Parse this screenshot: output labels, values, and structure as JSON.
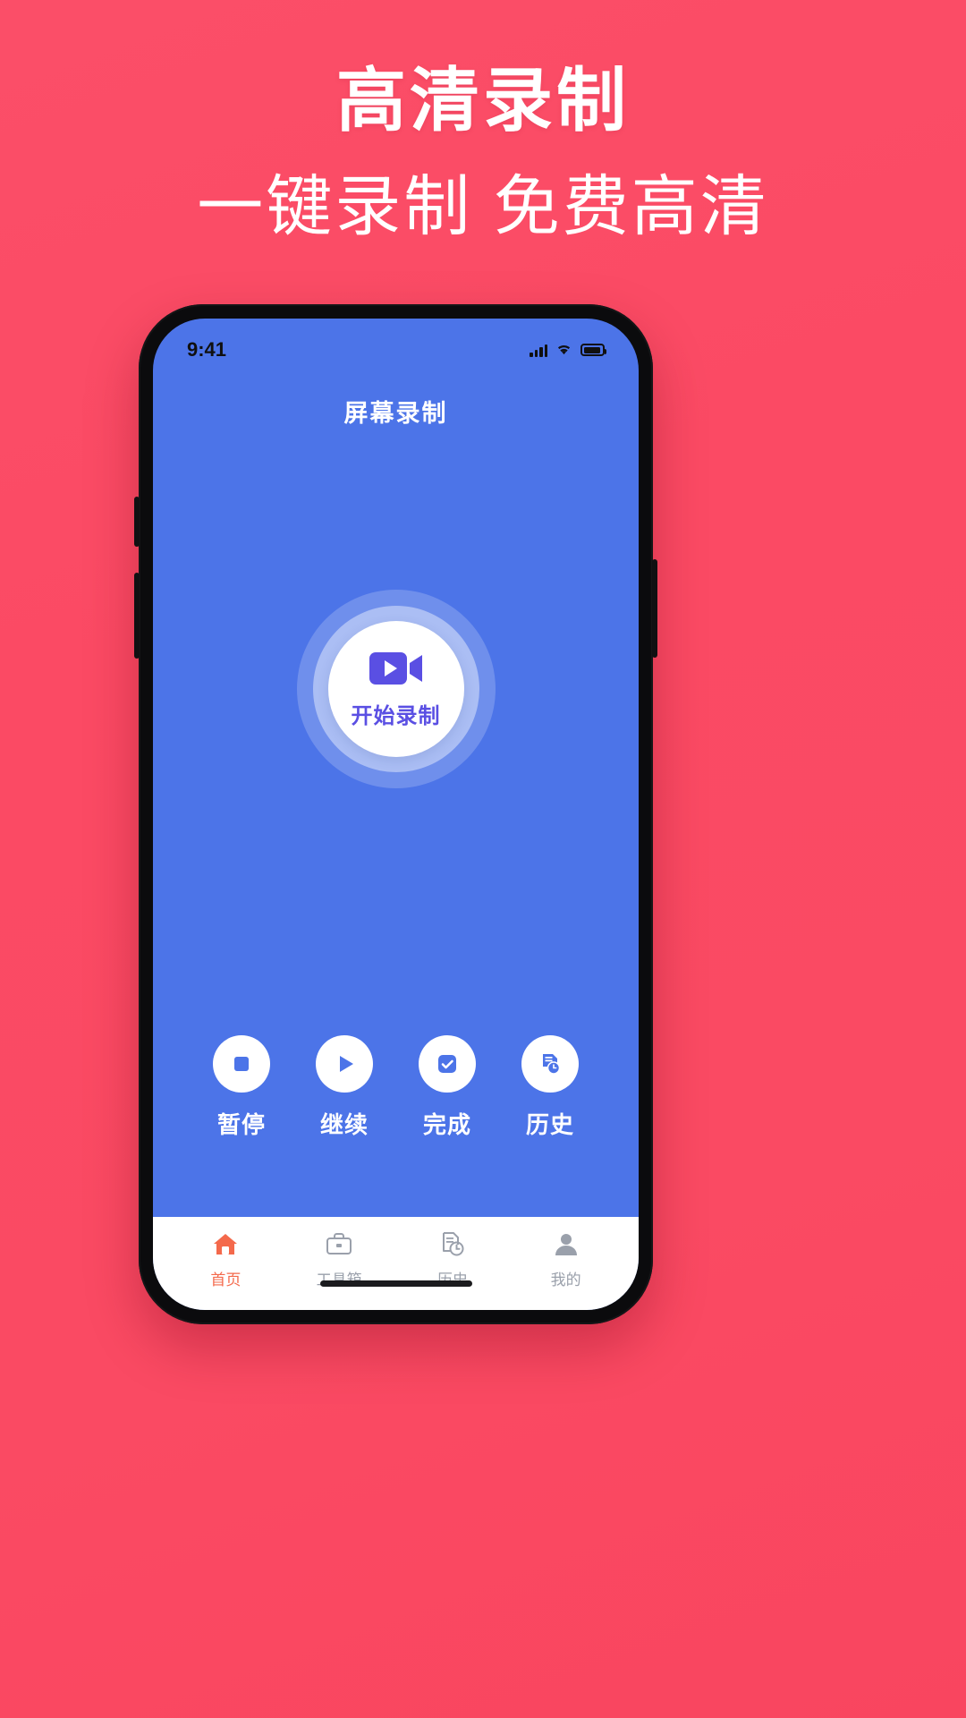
{
  "promo": {
    "title": "高清录制",
    "subtitle": "一键录制 免费高清",
    "bg_color_top": "#fb4e68",
    "bg_color_bottom": "#f9455f",
    "text_color": "#ffffff"
  },
  "phone": {
    "frame_color": "#0b0b0d",
    "screen_bg": "#4c74e8"
  },
  "statusbar": {
    "time": "9:41",
    "signal_icon": "cellular-signal-icon",
    "wifi_icon": "wifi-icon",
    "battery_icon": "battery-icon"
  },
  "app": {
    "title": "屏幕录制",
    "accent_color": "#5a4fe3"
  },
  "record": {
    "label": "开始录制",
    "icon": "video-camera-icon",
    "icon_color": "#5a4fe3"
  },
  "actions": [
    {
      "label": "暂停",
      "icon": "stop-square-icon"
    },
    {
      "label": "继续",
      "icon": "play-triangle-icon"
    },
    {
      "label": "完成",
      "icon": "check-badge-icon"
    },
    {
      "label": "历史",
      "icon": "history-document-icon"
    }
  ],
  "tabs": [
    {
      "label": "首页",
      "icon": "home-icon",
      "active": true
    },
    {
      "label": "工具箱",
      "icon": "toolbox-icon",
      "active": false
    },
    {
      "label": "历史",
      "icon": "history-icon",
      "active": false
    },
    {
      "label": "我的",
      "icon": "person-icon",
      "active": false
    }
  ],
  "colors": {
    "tab_active": "#f4694b",
    "tab_inactive": "#9aa0ab",
    "action_icon": "#4c74e8"
  }
}
